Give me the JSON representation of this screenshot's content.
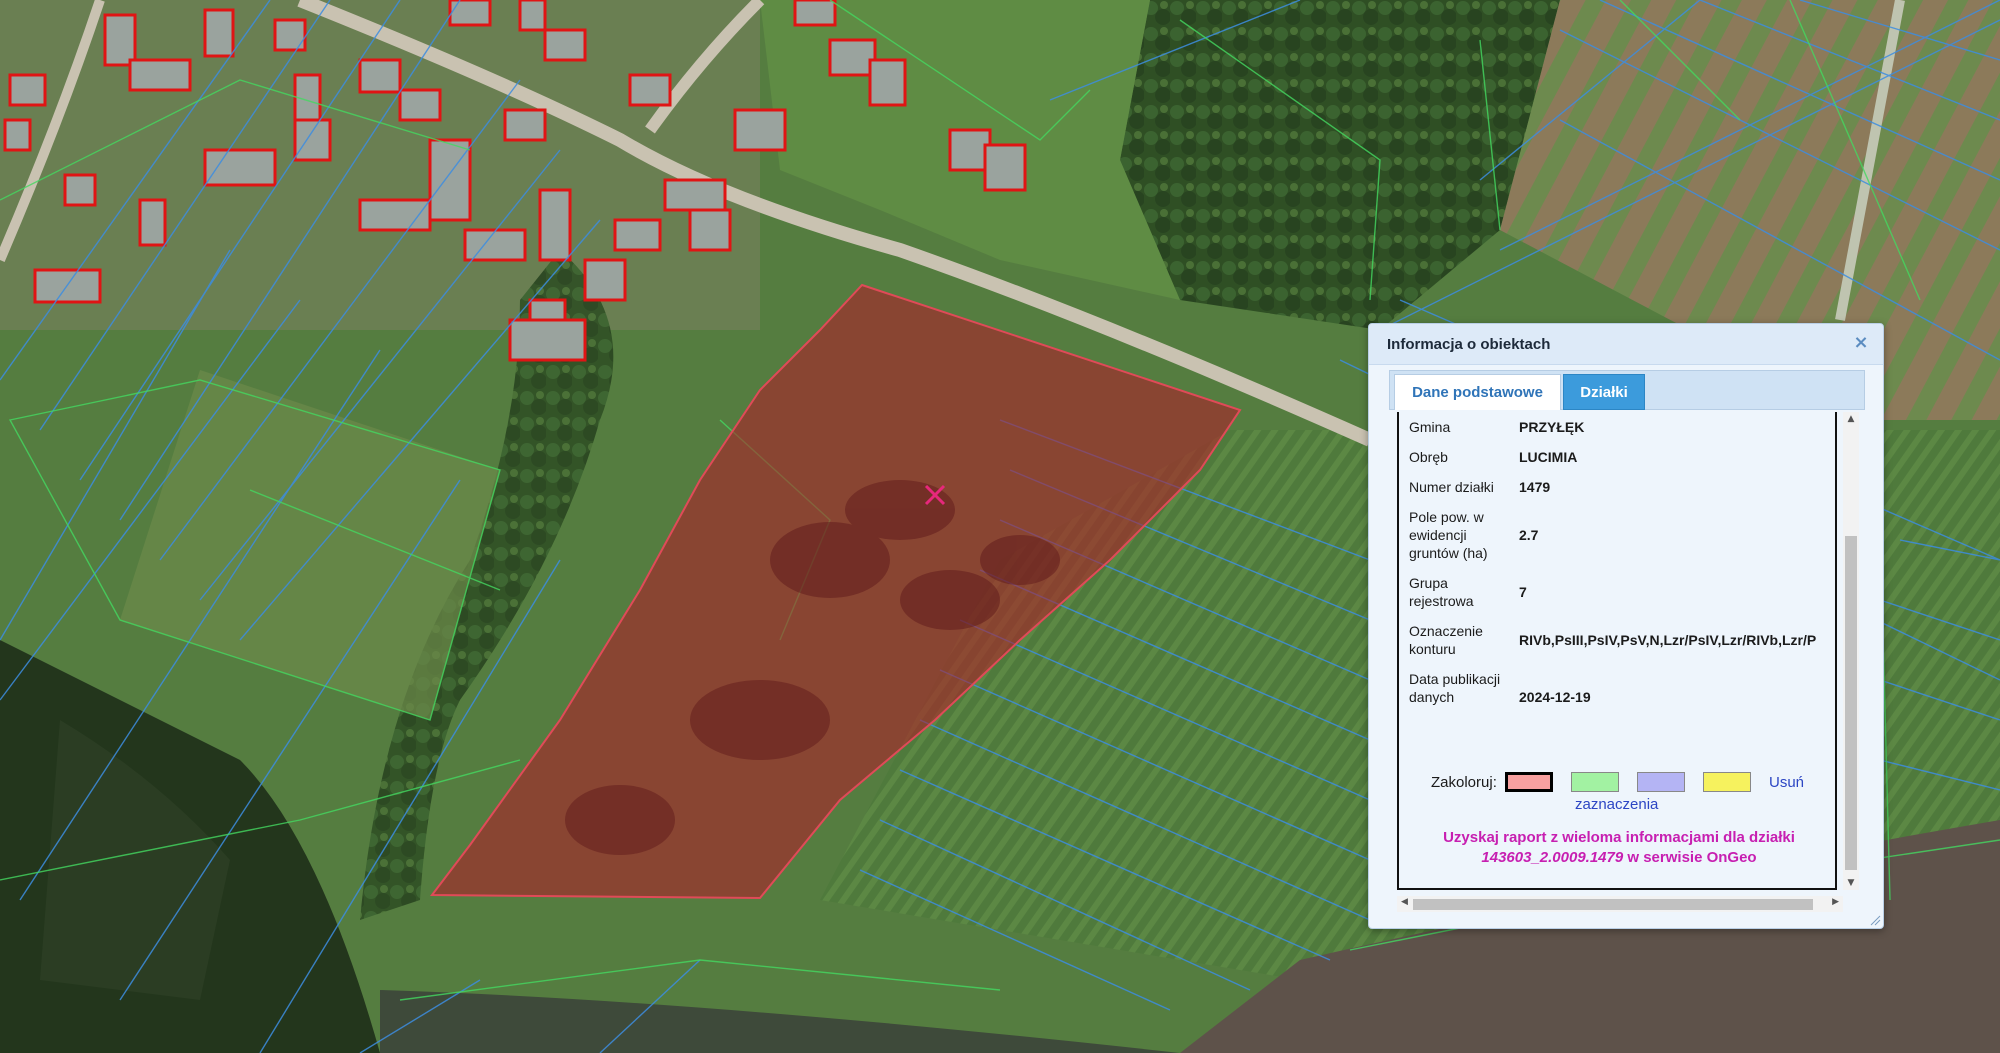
{
  "popup": {
    "title": "Informacja o obiektach",
    "close_icon": "close-icon",
    "tabs": [
      {
        "label": "Dane podstawowe",
        "active": true
      },
      {
        "label": "Działki",
        "active": false
      }
    ]
  },
  "parcel": {
    "rows": [
      {
        "label": "Gmina",
        "value": "PRZYŁĘK"
      },
      {
        "label": "Obręb",
        "value": "LUCIMIA"
      },
      {
        "label": "Numer działki",
        "value": "1479"
      },
      {
        "label": "Pole pow. w ewidencji gruntów (ha)",
        "value": "2.7"
      },
      {
        "label": "Grupa rejestrowa",
        "value": "7"
      },
      {
        "label": "Oznaczenie konturu",
        "value": "RIVb,PsIII,PsIV,PsV,N,Lzr/PsIV,Lzr/RIVb,Lzr/P"
      },
      {
        "label": "Data publikacji danych",
        "value": "2024-12-19"
      }
    ]
  },
  "colorize": {
    "label": "Zakoloruj:",
    "swatches": [
      "#f7a0a0",
      "#a2f2a2",
      "#b4b4f4",
      "#f6f25e"
    ],
    "selected_index": 0,
    "clear_label": "Usuń",
    "clear_label_2": "zaznaczenia"
  },
  "report": {
    "line1": "Uzyskaj raport z wieloma informacjami dla działki",
    "parcel_id": "143603_2.0009.1479",
    "line2_suffix": " w serwisie OnGeo"
  },
  "map": {
    "marker_icon": "cross-marker-icon",
    "highlight_color": "#b01e28"
  }
}
